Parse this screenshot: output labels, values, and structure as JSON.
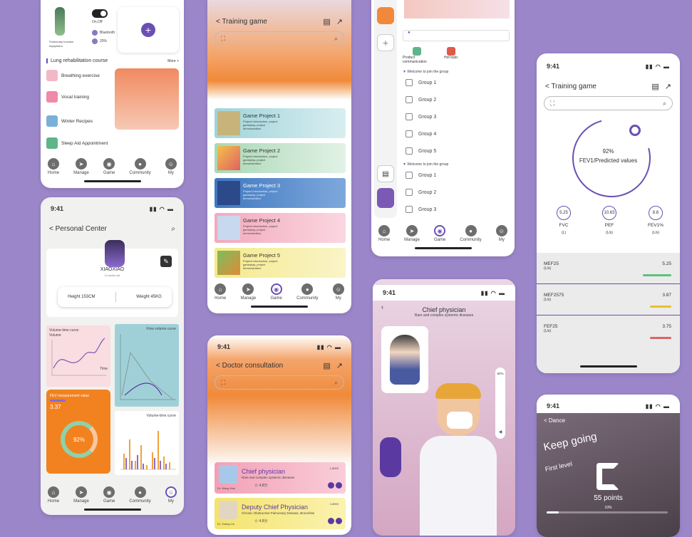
{
  "screen1": {
    "toggle_label": "On,Off",
    "bluetooth": "Bluetooth",
    "battery": "20%",
    "device": "Pulmonary function equipment",
    "course_title": "Lung rehabilitation course",
    "more": "More >",
    "courses": [
      "Breathing exercise",
      "Vocal training",
      "Winter Recipes",
      "Sleep Aid Appointment"
    ],
    "nav": [
      "Home",
      "Manage",
      "Game",
      "Community",
      "My"
    ]
  },
  "screen2": {
    "time": "9:41",
    "title": "< Personal Center",
    "username": "XIAOXIAO",
    "age": "12 years old",
    "height": "Height  153CM",
    "weight": "Weight  45KG",
    "chart1_title": "Volume-time curve",
    "chart1_ylabel": "Volume",
    "chart1_xlabel": "Time",
    "chart2_title": "Flow volume curve",
    "chart3_label": "FEV measurement value",
    "chart3_value": "3.37",
    "chart3_pct": "92%",
    "chart4_title": "Volume-time curve",
    "nav": [
      "Home",
      "Manage",
      "Game",
      "Community",
      "My"
    ]
  },
  "screen3": {
    "title": "< Training game",
    "projects": [
      {
        "name": "Game Project 1",
        "desc": "Project introduction, project gameplay, project demonstration"
      },
      {
        "name": "Game Project 2",
        "desc": "Project introduction, project gameplay, project demonstration"
      },
      {
        "name": "Game Project 3",
        "desc": "Project introduction, project gameplay, project demonstration"
      },
      {
        "name": "Game Project 4",
        "desc": "Project introduction, project gameplay, project demonstration"
      },
      {
        "name": "Game Project 5",
        "desc": "Project introduction, project gameplay, project demonstration"
      }
    ],
    "nav": [
      "Home",
      "Manage",
      "Game",
      "Community",
      "My"
    ]
  },
  "screen4": {
    "time": "9:41",
    "title": "< Doctor consultation",
    "doctors": [
      {
        "title": "Chief physician",
        "desc": "Rare and complex systemic diseases",
        "name": "Dr. Wang Hao",
        "rating": "4.8分",
        "tag": "1.8000"
      },
      {
        "title": "Deputy Chief Physician",
        "desc": "Chronic Obstructive Pulmonary Disease, Bronchitis",
        "name": "Dr. Zhang Lin",
        "rating": "4.8分",
        "tag": "1.8000"
      }
    ]
  },
  "screen5": {
    "cat1": "Product communication",
    "cat2": "Hot topic",
    "section1": "Welcome to join the group",
    "groups1": [
      "Group 1",
      "Group 2",
      "Group 3",
      "Group 4",
      "Group 5"
    ],
    "section2": "Welcome to join the group",
    "groups2": [
      "Group 1",
      "Group 2",
      "Group 3"
    ],
    "nav": [
      "Home",
      "Manage",
      "Game",
      "Community",
      "My"
    ]
  },
  "screen6": {
    "time": "9:41",
    "title": "Chief physician",
    "desc": "Rare and complex systemic diseases",
    "volume": "92%"
  },
  "screen7": {
    "time": "9:41",
    "title": "< Training game",
    "pct": "92%",
    "pct_label": "FEV1/Predicted values",
    "metrics": [
      {
        "value": "5.25",
        "name": "FVC",
        "unit": "(L)"
      },
      {
        "value": "10.63",
        "name": "PEF",
        "unit": "(L/s)"
      },
      {
        "value": "8.8",
        "name": "FEV1%",
        "unit": "(L/s)"
      }
    ],
    "rows": [
      {
        "name": "MEF25",
        "unit": "(L/s)",
        "value": "5.25",
        "color": "#5cc27a"
      },
      {
        "name": "MEF2575",
        "unit": "(L/s)",
        "value": "3.87",
        "color": "#e8c22c"
      },
      {
        "name": "FEF25",
        "unit": "(L/s)",
        "value": "3.75",
        "color": "#e06262"
      }
    ]
  },
  "screen8": {
    "time": "9:41",
    "title": "< Dance",
    "keep": "Keep going",
    "level": "First level",
    "points": "55 points",
    "progress": "10%"
  }
}
